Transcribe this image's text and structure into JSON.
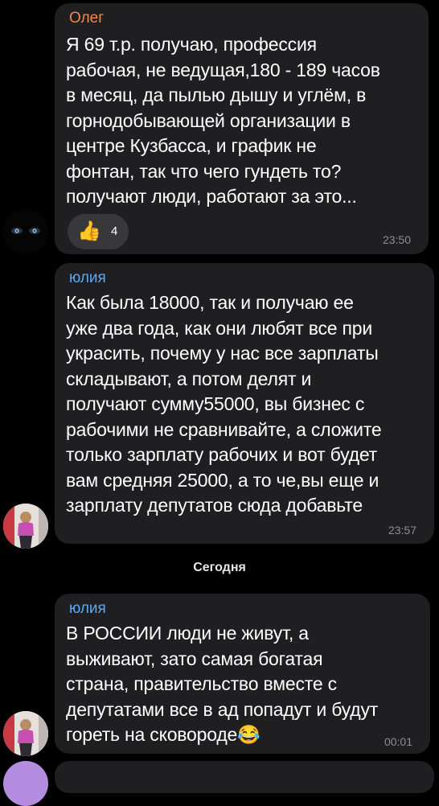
{
  "messages": [
    {
      "author": "Олег",
      "author_color": "#f0874e",
      "lines": [
        "Я 69 т.р. получаю, профессия",
        "рабочая, не ведущая,180 - 189 часов",
        "в месяц, да пылью дышу и углём, в",
        "горнодобывающей организации в",
        "центре Кузбасса, и график не",
        "фонтан, так что чего гундеть то?",
        "получают люди, работают за это..."
      ],
      "reaction_emoji": "👍",
      "reaction_count": "4",
      "time": "23:50"
    },
    {
      "author": "юлия",
      "author_color": "#5ea8f0",
      "lines": [
        "Как была 18000, так и получаю ее",
        "уже два года, как они любят все при",
        "украсить, почему у нас все зарплаты",
        "складывают, а потом делят и",
        "получают сумму55000, вы бизнес с",
        "рабочими не сравнивайте, а сложите",
        "только зарплату рабочих и вот будет",
        "вам средняя 25000, а то че,вы еще и",
        "зарплату депутатов сюда добавьте"
      ],
      "time": "23:57"
    },
    {
      "author": "юлия",
      "author_color": "#5ea8f0",
      "lines": [
        "В РОССИИ люди не живут, а",
        "выживают, зато самая богатая",
        "страна, правительство вместе с",
        "депутатами все в ад попадут и будут",
        "гореть на сковороде"
      ],
      "emoji": "😂",
      "time": "00:01"
    }
  ],
  "date_separator": "Сегодня",
  "colors": {
    "background": "#000000",
    "bubble": "#1f1f21",
    "reaction_pill": "#38383a",
    "time": "#8e8e93"
  }
}
